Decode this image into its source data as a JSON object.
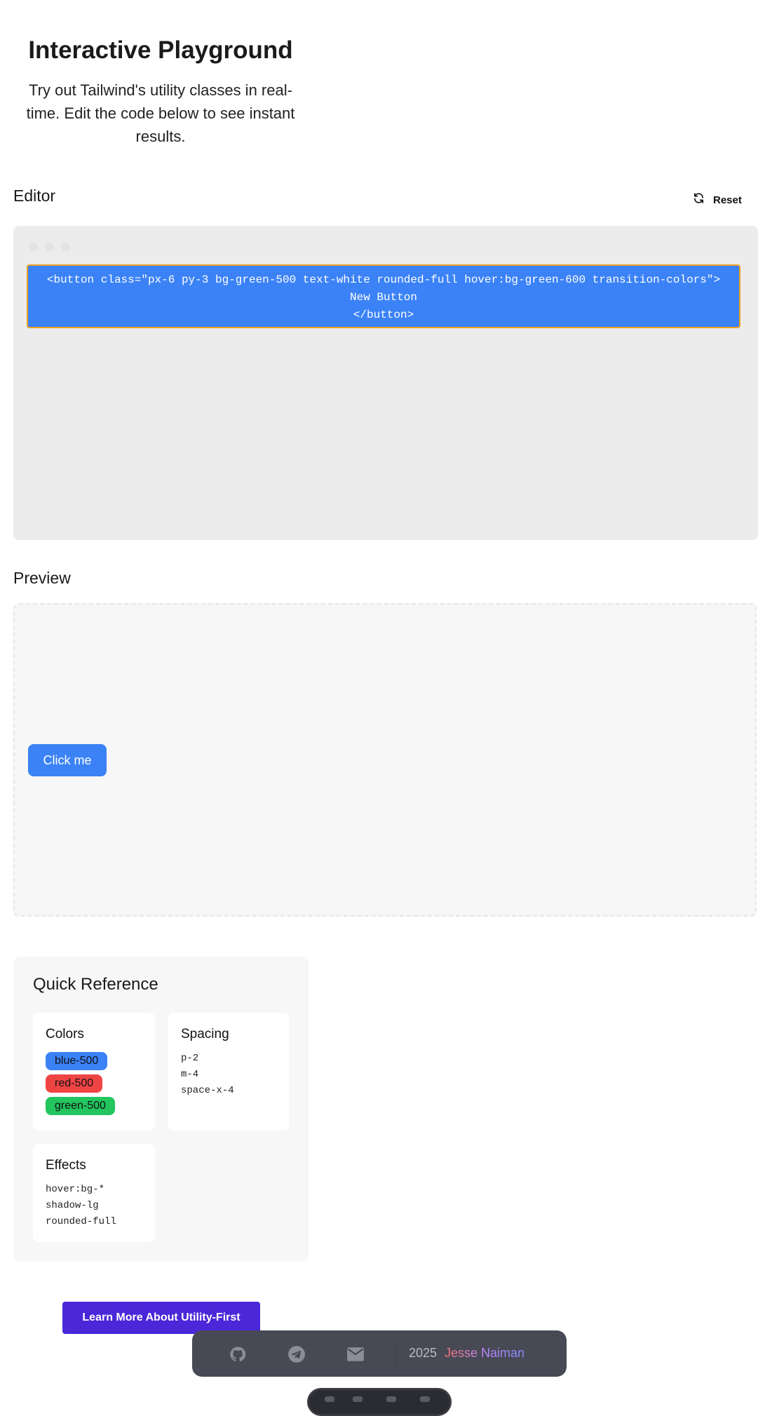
{
  "hero": {
    "title": "Interactive Playground",
    "subtitle": "Try out Tailwind's utility classes in real-time. Edit the code below to see instant results."
  },
  "editor": {
    "heading": "Editor",
    "reset_label": "Reset",
    "code_lines": [
      "<button class=\"px-6 py-3 bg-green-500 text-white rounded-full hover:bg-green-600 transition-colors\">",
      "New Button",
      "</button>"
    ]
  },
  "preview": {
    "heading": "Preview",
    "button_label": "Click me"
  },
  "quick_reference": {
    "heading": "Quick Reference",
    "colors": {
      "title": "Colors",
      "chips": [
        {
          "label": "blue-500",
          "color": "#3b82f6"
        },
        {
          "label": "red-500",
          "color": "#ef4444"
        },
        {
          "label": "green-500",
          "color": "#22c55e"
        }
      ]
    },
    "spacing": {
      "title": "Spacing",
      "items": [
        "p-2",
        "m-4",
        "space-x-4"
      ]
    },
    "effects": {
      "title": "Effects",
      "items": [
        "hover:bg-*",
        "shadow-lg",
        "rounded-full"
      ]
    }
  },
  "cta": {
    "label": "Learn More About Utility-First"
  },
  "footer": {
    "icons": [
      "github-icon",
      "telegram-icon",
      "mail-icon"
    ],
    "year": "2025",
    "author": "Jesse Naiman"
  },
  "colors": {
    "accent_blue": "#3b82f6",
    "cta_purple": "#4a27d9",
    "footer_bg": "#474a55",
    "editor_border": "#f0a020"
  }
}
